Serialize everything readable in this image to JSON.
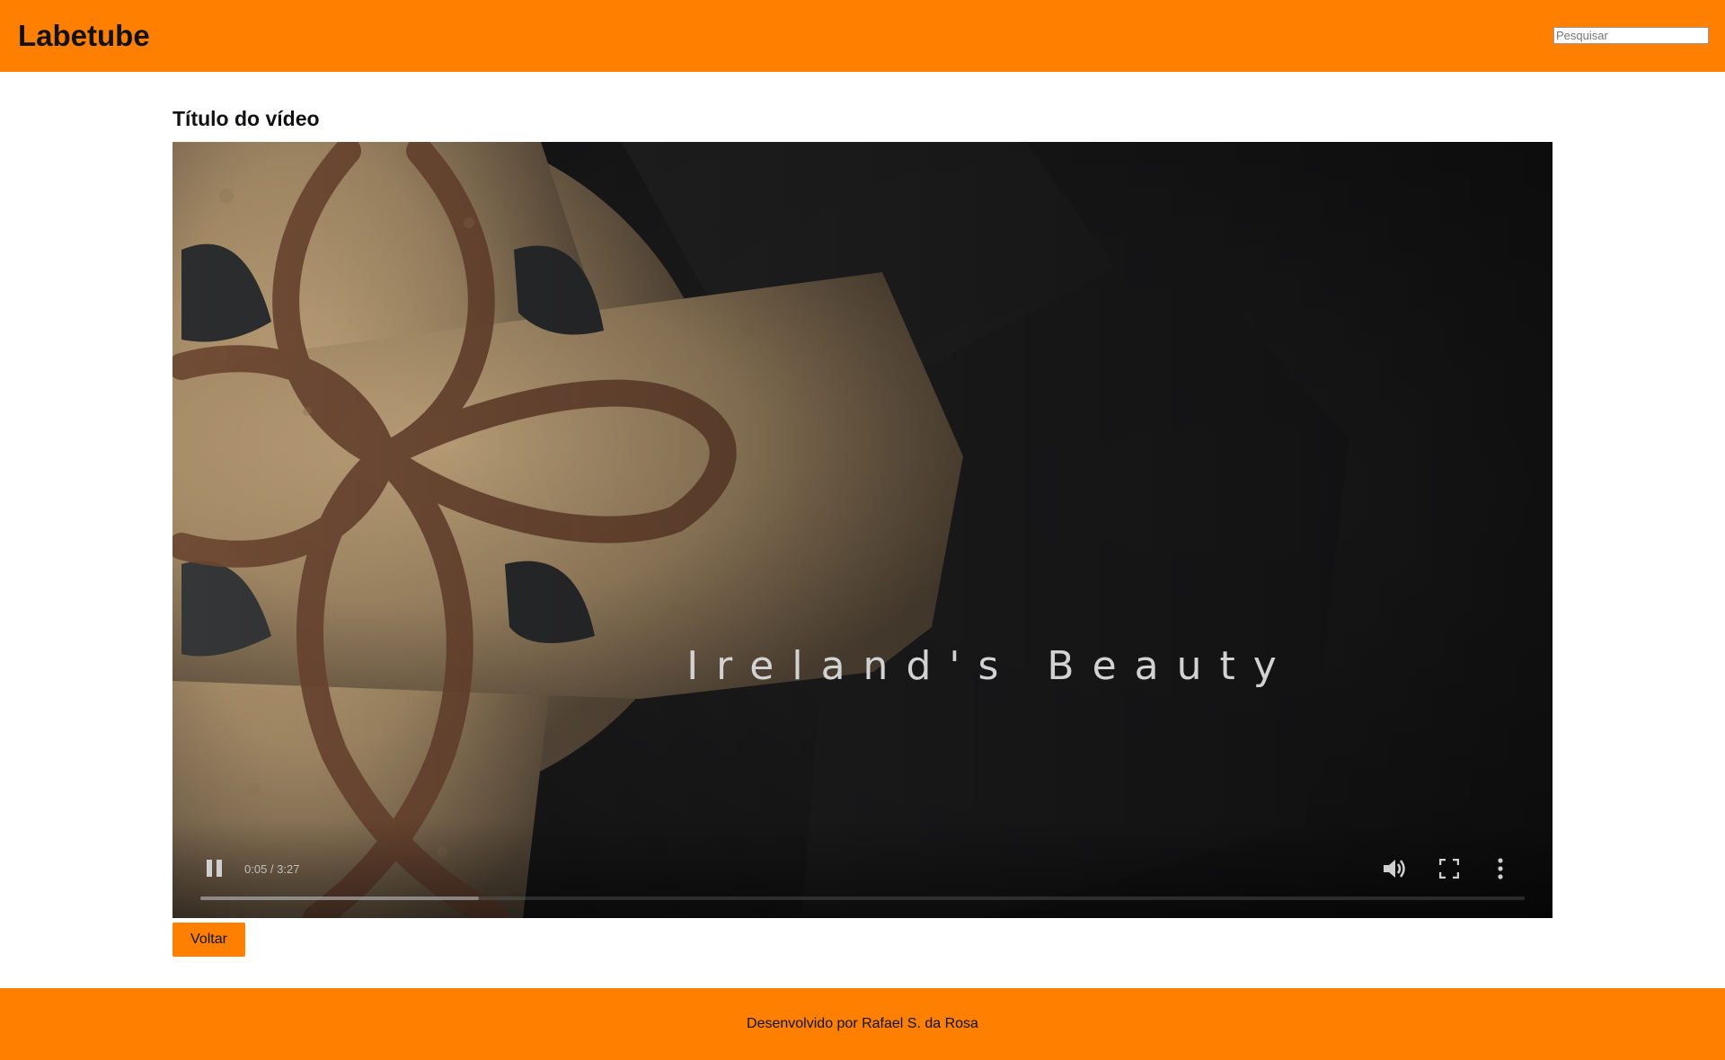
{
  "header": {
    "logo": "Labetube",
    "search": {
      "placeholder": "Pesquisar",
      "value": ""
    }
  },
  "video": {
    "title": "Título do vídeo",
    "overlay_text": "Ireland's Beauty",
    "time_display": "0:05 / 3:27",
    "progress_fraction": 0.21,
    "state": "playing",
    "icons": [
      "pause-icon",
      "volume-icon",
      "fullscreen-icon",
      "more-options-icon"
    ]
  },
  "actions": {
    "back_label": "Voltar"
  },
  "footer": {
    "credit": "Desenvolvido por Rafael S. da Rosa"
  },
  "colors": {
    "brand_orange": "#ff8000",
    "page_background": "#ffffff",
    "player_background": "#1a1a1b"
  }
}
